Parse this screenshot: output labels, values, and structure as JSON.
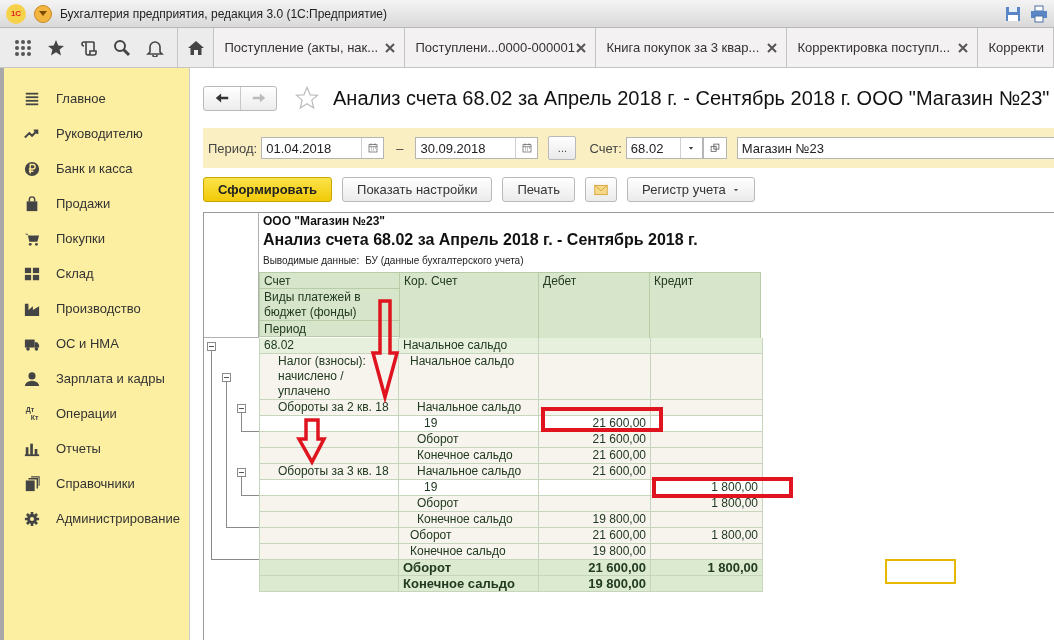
{
  "app": {
    "logo": "1С",
    "title": "Бухгалтерия предприятия, редакция 3.0  (1С:Предприятие)"
  },
  "tabs": [
    {
      "label": "Поступление (акты, нак...",
      "selected": false,
      "closable": true
    },
    {
      "label": "Поступлени...0000-000001",
      "selected": false,
      "closable": true
    },
    {
      "label": "Книга покупок за 3 квар...",
      "selected": false,
      "closable": true
    },
    {
      "label": "Корректировка поступл...",
      "selected": false,
      "closable": true
    },
    {
      "label": "Корректи",
      "selected": false,
      "closable": false
    }
  ],
  "sidebar": {
    "items": [
      {
        "label": "Главное"
      },
      {
        "label": "Руководителю"
      },
      {
        "label": "Банк и касса"
      },
      {
        "label": "Продажи"
      },
      {
        "label": "Покупки"
      },
      {
        "label": "Склад"
      },
      {
        "label": "Производство"
      },
      {
        "label": "ОС и НМА"
      },
      {
        "label": "Зарплата и кадры"
      },
      {
        "label": "Операции",
        "icon_text_top": "Дт",
        "icon_text_bottom": "Кт"
      },
      {
        "label": "Отчеты"
      },
      {
        "label": "Справочники"
      },
      {
        "label": "Администрирование"
      }
    ]
  },
  "form": {
    "title": "Анализ счета 68.02 за Апрель 2018 г. - Сентябрь 2018 г. ООО \"Магазин №23\"",
    "favorite": false,
    "back_disabled": false,
    "forward_disabled": true
  },
  "filters": {
    "period_label": "Период:",
    "date_from": "01.04.2018",
    "dash": "–",
    "date_to": "30.09.2018",
    "more_button": "...",
    "account_label": "Счет:",
    "account": "68.02",
    "organization": "Магазин №23"
  },
  "buttons": [
    {
      "label": "Сформировать",
      "kind": "primary"
    },
    {
      "label": "Показать настройки",
      "kind": "normal"
    },
    {
      "label": "Печать",
      "kind": "normal"
    },
    {
      "kind": "mail"
    },
    {
      "label": "Регистр учета",
      "kind": "dropdown"
    }
  ],
  "report": {
    "organization": "ООО \"Магазин №23\"",
    "title": "Анализ счета 68.02 за Апрель 2018 г. - Сентябрь 2018 г.",
    "output_label": "Выводимые данные:",
    "output_value": "БУ (данные бухгалтерского учета)",
    "header": {
      "group_columns": [
        "Счет",
        "Виды платежей в бюджет (фонды)",
        "Период"
      ],
      "columns": [
        "Кор. Счет",
        "Дебет",
        "Кредит"
      ]
    },
    "tree": [
      {
        "kind": "group",
        "label": "68.02",
        "expanded": true,
        "rows": [
          {
            "account": "Начальное сальдо"
          }
        ],
        "children": [
          {
            "kind": "group",
            "label": "Налог (взносы): начислено / уплачено",
            "expanded": true,
            "rows": [
              {
                "account": "Начальное сальдо"
              }
            ],
            "children": [
              {
                "kind": "group",
                "label": "Обороты за 2 кв. 18",
                "expanded": true,
                "rows": [
                  {
                    "account": "Начальное сальдо"
                  }
                ],
                "children": [
                  {
                    "kind": "entry",
                    "account": "19",
                    "debit": "21 600,00",
                    "debit_highlighted": true
                  }
                ],
                "totals": [
                  {
                    "account": "Оборот",
                    "debit": "21 600,00"
                  },
                  {
                    "account": "Конечное сальдо",
                    "debit": "21 600,00"
                  }
                ]
              },
              {
                "kind": "group",
                "label": "Обороты за 3 кв. 18",
                "expanded": true,
                "rows": [
                  {
                    "account": "Начальное сальдо",
                    "debit": "21 600,00"
                  }
                ],
                "children": [
                  {
                    "kind": "entry",
                    "account": "19",
                    "credit": "1 800,00",
                    "credit_highlighted": true
                  }
                ],
                "totals": [
                  {
                    "account": "Оборот",
                    "credit": "1 800,00"
                  },
                  {
                    "account": "Конечное сальдо",
                    "debit": "19 800,00"
                  }
                ]
              }
            ],
            "totals": [
              {
                "account": "Оборот",
                "debit": "21 600,00",
                "credit": "1 800,00"
              },
              {
                "account": "Конечное сальдо",
                "debit": "19 800,00"
              }
            ]
          }
        ],
        "totals": [
          {
            "account": "Оборот",
            "debit": "21 600,00",
            "credit": "1 800,00"
          },
          {
            "account": "Конечное сальдо",
            "debit": "19 800,00"
          }
        ]
      }
    ]
  }
}
